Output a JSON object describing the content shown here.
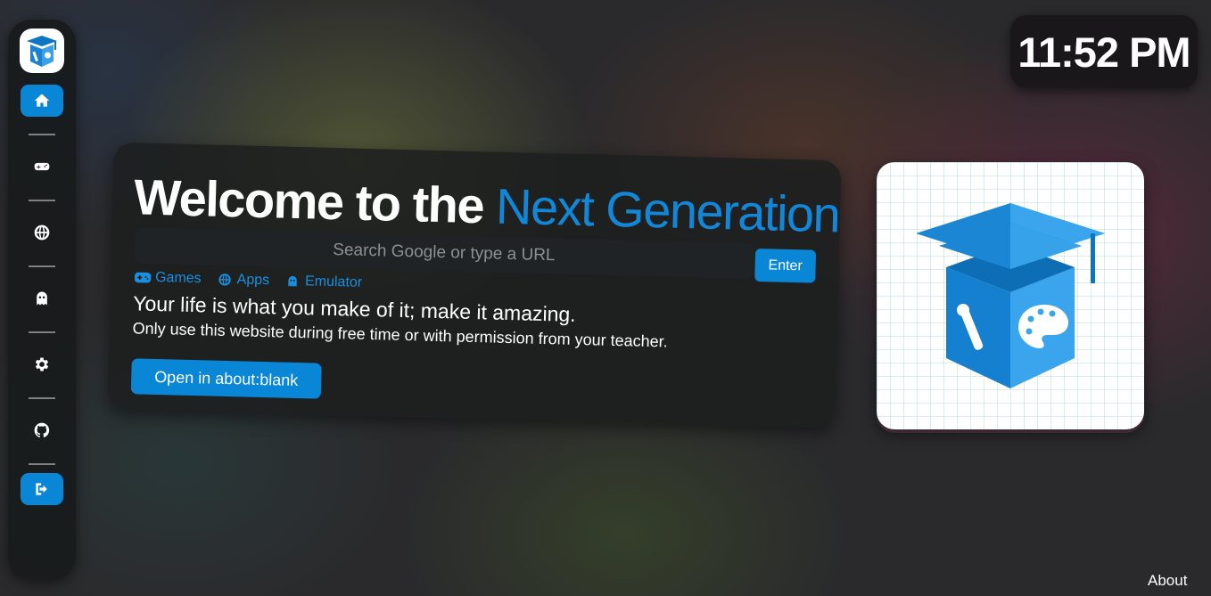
{
  "sidebar": {
    "logo_icon": "graduation-cube-logo-icon",
    "items": [
      {
        "name": "home",
        "icon": "home-icon",
        "active": true
      },
      {
        "name": "games",
        "icon": "gamepad-icon",
        "active": false
      },
      {
        "name": "apps",
        "icon": "globe-icon",
        "active": false
      },
      {
        "name": "emulator",
        "icon": "ghost-icon",
        "active": false
      },
      {
        "name": "settings",
        "icon": "gear-icon",
        "active": false
      },
      {
        "name": "github",
        "icon": "github-icon",
        "active": false
      },
      {
        "name": "exit",
        "icon": "sign-out-icon",
        "active": true
      }
    ]
  },
  "clock": {
    "time": "11:52 PM"
  },
  "welcome": {
    "title_prefix": "Welcome to the",
    "title_accent": "Next Generation",
    "search_placeholder": "Search Google or type a URL",
    "enter_label": "Enter",
    "links": [
      {
        "label": "Games",
        "icon": "gamepad-icon"
      },
      {
        "label": "Apps",
        "icon": "globe-icon"
      },
      {
        "label": "Emulator",
        "icon": "ghost-icon"
      }
    ],
    "tagline": "Your life is what you make of it; make it amazing.",
    "subline": "Only use this website during free time or with permission from your teacher.",
    "blank_button": "Open in about:blank"
  },
  "footer": {
    "about_label": "About"
  },
  "colors": {
    "accent": "#0a86d6",
    "panel": "#1c1e1e"
  }
}
